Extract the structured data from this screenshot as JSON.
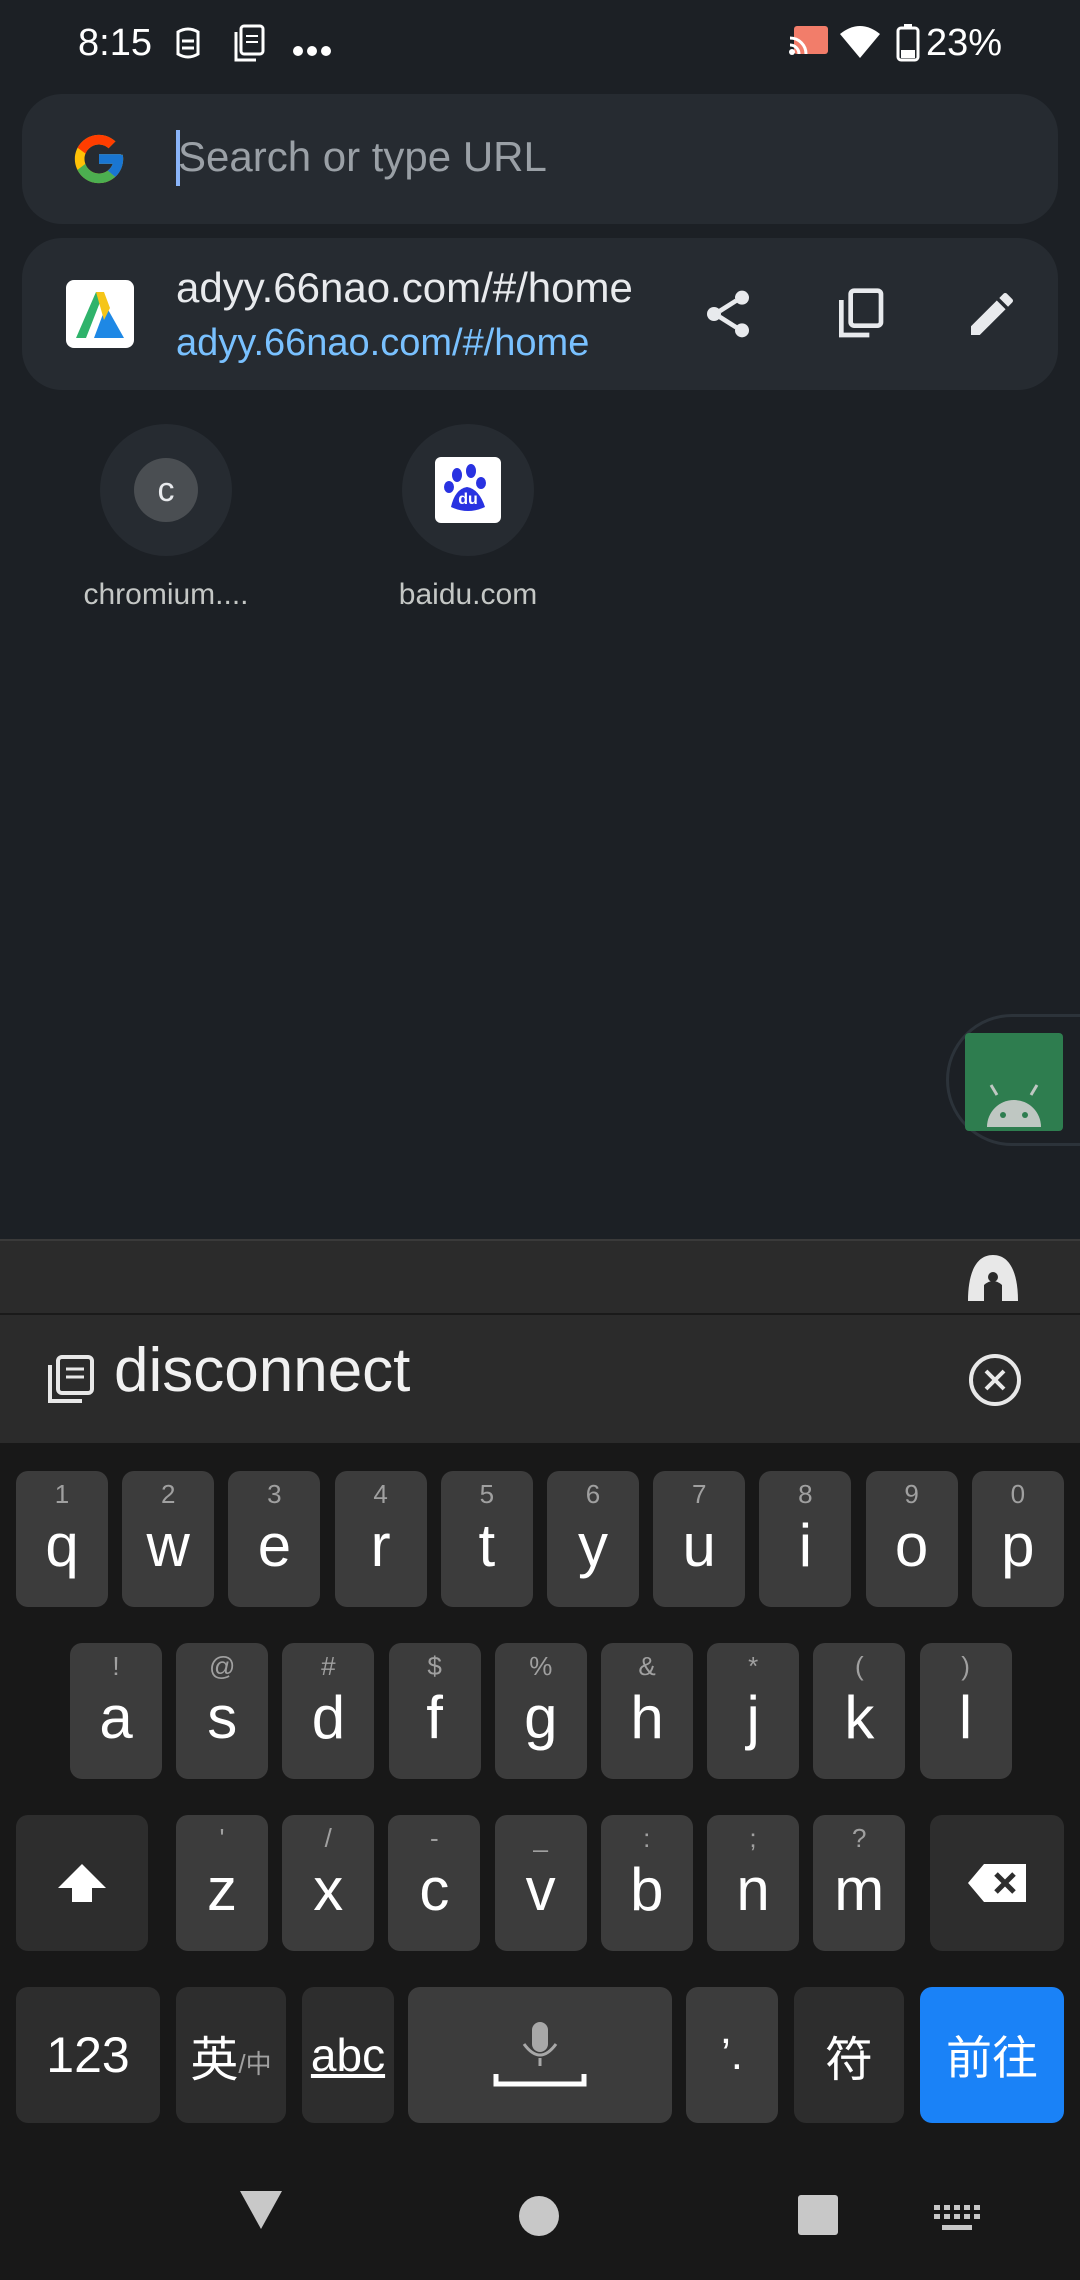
{
  "status_bar": {
    "time": "8:15",
    "battery": "23%",
    "icons": [
      "assistant-icon",
      "clipboard-icon",
      "more-dots-icon",
      "cast-icon",
      "wifi-icon",
      "battery-icon"
    ]
  },
  "search": {
    "placeholder": "Search or type URL",
    "value": ""
  },
  "suggestion": {
    "title": "adyy.66nao.com/#/home",
    "url": "adyy.66nao.com/#/home",
    "actions": [
      "share-icon",
      "copy-icon",
      "edit-icon"
    ]
  },
  "tiles": [
    {
      "label": "chromium....",
      "letter": "c"
    },
    {
      "label": "baidu.com",
      "icon": "baidu-icon",
      "icon_text": "du"
    }
  ],
  "keyboard": {
    "clipboard_text": "disconnect",
    "row1": [
      {
        "key": "q",
        "hint": "1"
      },
      {
        "key": "w",
        "hint": "2"
      },
      {
        "key": "e",
        "hint": "3"
      },
      {
        "key": "r",
        "hint": "4"
      },
      {
        "key": "t",
        "hint": "5"
      },
      {
        "key": "y",
        "hint": "6"
      },
      {
        "key": "u",
        "hint": "7"
      },
      {
        "key": "i",
        "hint": "8"
      },
      {
        "key": "o",
        "hint": "9"
      },
      {
        "key": "p",
        "hint": "0"
      }
    ],
    "row2": [
      {
        "key": "a",
        "hint": "!"
      },
      {
        "key": "s",
        "hint": "@"
      },
      {
        "key": "d",
        "hint": "#"
      },
      {
        "key": "f",
        "hint": "$"
      },
      {
        "key": "g",
        "hint": "%"
      },
      {
        "key": "h",
        "hint": "&"
      },
      {
        "key": "j",
        "hint": "*"
      },
      {
        "key": "k",
        "hint": "("
      },
      {
        "key": "l",
        "hint": ")"
      }
    ],
    "row3": [
      {
        "key": "z",
        "hint": "'"
      },
      {
        "key": "x",
        "hint": "/"
      },
      {
        "key": "c",
        "hint": "-"
      },
      {
        "key": "v",
        "hint": "_"
      },
      {
        "key": "b",
        "hint": ":"
      },
      {
        "key": "n",
        "hint": ";"
      },
      {
        "key": "m",
        "hint": "?"
      }
    ],
    "num_label": "123",
    "lang_main": "英",
    "lang_sub": "/中",
    "abc_label": "abc",
    "punct_label": "’.",
    "symbol_label": "符",
    "go_label": "前往"
  },
  "colors": {
    "background": "#1c2025",
    "card": "#262b31",
    "link": "#79c1ff",
    "go_key": "#1a82f7"
  }
}
